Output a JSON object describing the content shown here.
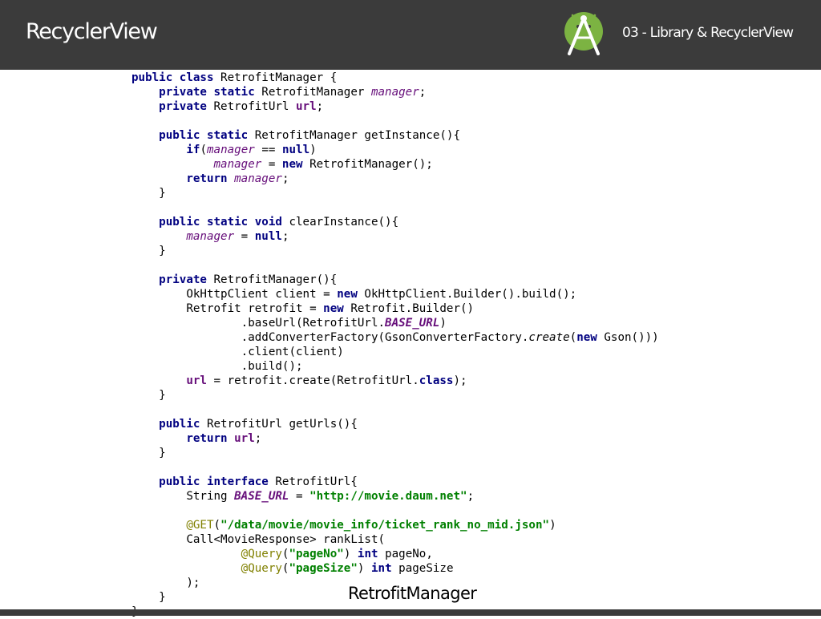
{
  "header": {
    "title": "RecyclerView",
    "section": "03 - Library & RecyclerView",
    "logo_icon": "android-studio-icon",
    "background": "#3b3b3b"
  },
  "caption": "RetrofitManager",
  "syntax_colors": {
    "keyword": "#000080",
    "field": "#660e7a",
    "string": "#008000",
    "annotation": "#808000"
  },
  "code_lines": [
    [
      {
        "t": "public class ",
        "c": "kw"
      },
      {
        "t": "RetrofitManager {"
      }
    ],
    [
      {
        "t": "    "
      },
      {
        "t": "private static ",
        "c": "kw"
      },
      {
        "t": "RetrofitManager "
      },
      {
        "t": "manager",
        "c": "fld"
      },
      {
        "t": ";"
      }
    ],
    [
      {
        "t": "    "
      },
      {
        "t": "private ",
        "c": "kw"
      },
      {
        "t": "RetrofitUrl "
      },
      {
        "t": "url",
        "c": "ifld"
      },
      {
        "t": ";"
      }
    ],
    [],
    [
      {
        "t": "    "
      },
      {
        "t": "public static ",
        "c": "kw"
      },
      {
        "t": "RetrofitManager getInstance(){"
      }
    ],
    [
      {
        "t": "        "
      },
      {
        "t": "if",
        "c": "kw"
      },
      {
        "t": "("
      },
      {
        "t": "manager",
        "c": "fld"
      },
      {
        "t": " == "
      },
      {
        "t": "null",
        "c": "kw"
      },
      {
        "t": ")"
      }
    ],
    [
      {
        "t": "            "
      },
      {
        "t": "manager",
        "c": "fld"
      },
      {
        "t": " = "
      },
      {
        "t": "new ",
        "c": "kw"
      },
      {
        "t": "RetrofitManager();"
      }
    ],
    [
      {
        "t": "        "
      },
      {
        "t": "return ",
        "c": "kw"
      },
      {
        "t": "manager",
        "c": "fld"
      },
      {
        "t": ";"
      }
    ],
    [
      {
        "t": "    }"
      }
    ],
    [],
    [
      {
        "t": "    "
      },
      {
        "t": "public static void ",
        "c": "kw"
      },
      {
        "t": "clearInstance(){"
      }
    ],
    [
      {
        "t": "        "
      },
      {
        "t": "manager",
        "c": "fld"
      },
      {
        "t": " = "
      },
      {
        "t": "null",
        "c": "kw"
      },
      {
        "t": ";"
      }
    ],
    [
      {
        "t": "    }"
      }
    ],
    [],
    [
      {
        "t": "    "
      },
      {
        "t": "private ",
        "c": "kw"
      },
      {
        "t": "RetrofitManager(){"
      }
    ],
    [
      {
        "t": "        OkHttpClient client = "
      },
      {
        "t": "new ",
        "c": "kw"
      },
      {
        "t": "OkHttpClient.Builder().build();"
      }
    ],
    [
      {
        "t": "        Retrofit retrofit = "
      },
      {
        "t": "new ",
        "c": "kw"
      },
      {
        "t": "Retrofit.Builder()"
      }
    ],
    [
      {
        "t": "                .baseUrl(RetrofitUrl."
      },
      {
        "t": "BASE_URL",
        "c": "sfld"
      },
      {
        "t": ")"
      }
    ],
    [
      {
        "t": "                .addConverterFactory(GsonConverterFactory."
      },
      {
        "t": "create",
        "c": "mth"
      },
      {
        "t": "("
      },
      {
        "t": "new ",
        "c": "kw"
      },
      {
        "t": "Gson()))"
      }
    ],
    [
      {
        "t": "                .client(client)"
      }
    ],
    [
      {
        "t": "                .build();"
      }
    ],
    [
      {
        "t": "        "
      },
      {
        "t": "url",
        "c": "ifld"
      },
      {
        "t": " = retrofit.create(RetrofitUrl."
      },
      {
        "t": "class",
        "c": "kw"
      },
      {
        "t": ");"
      }
    ],
    [
      {
        "t": "    }"
      }
    ],
    [],
    [
      {
        "t": "    "
      },
      {
        "t": "public ",
        "c": "kw"
      },
      {
        "t": "RetrofitUrl getUrls(){"
      }
    ],
    [
      {
        "t": "        "
      },
      {
        "t": "return ",
        "c": "kw"
      },
      {
        "t": "url",
        "c": "ifld"
      },
      {
        "t": ";"
      }
    ],
    [
      {
        "t": "    }"
      }
    ],
    [],
    [
      {
        "t": "    "
      },
      {
        "t": "public interface ",
        "c": "kw"
      },
      {
        "t": "RetrofitUrl{"
      }
    ],
    [
      {
        "t": "        String "
      },
      {
        "t": "BASE_URL",
        "c": "sfld"
      },
      {
        "t": " = "
      },
      {
        "t": "\"http://movie.daum.net\"",
        "c": "str"
      },
      {
        "t": ";"
      }
    ],
    [],
    [
      {
        "t": "        "
      },
      {
        "t": "@GET",
        "c": "ann"
      },
      {
        "t": "("
      },
      {
        "t": "\"/data/movie/movie_info/ticket_rank_no_mid.json\"",
        "c": "str"
      },
      {
        "t": ")"
      }
    ],
    [
      {
        "t": "        Call<MovieResponse> rankList("
      }
    ],
    [
      {
        "t": "                "
      },
      {
        "t": "@Query",
        "c": "ann"
      },
      {
        "t": "("
      },
      {
        "t": "\"pageNo\"",
        "c": "str"
      },
      {
        "t": ") "
      },
      {
        "t": "int ",
        "c": "kw"
      },
      {
        "t": "pageNo,"
      }
    ],
    [
      {
        "t": "                "
      },
      {
        "t": "@Query",
        "c": "ann"
      },
      {
        "t": "("
      },
      {
        "t": "\"pageSize\"",
        "c": "str"
      },
      {
        "t": ") "
      },
      {
        "t": "int ",
        "c": "kw"
      },
      {
        "t": "pageSize"
      }
    ],
    [
      {
        "t": "        );"
      }
    ],
    [
      {
        "t": "    }"
      }
    ],
    [
      {
        "t": "}"
      }
    ]
  ]
}
